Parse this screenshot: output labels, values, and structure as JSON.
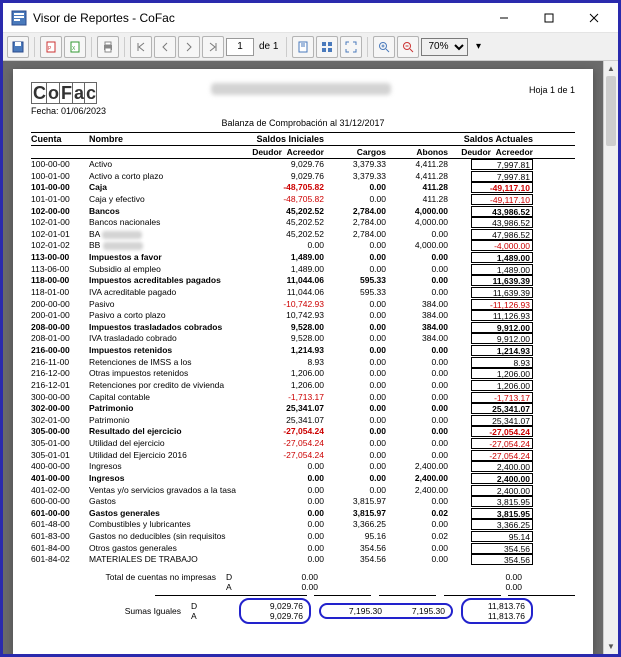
{
  "window": {
    "title": "Visor de Reportes - CoFac"
  },
  "toolbar": {
    "page_input": "1",
    "of_label": "de 1",
    "zoom": "70%"
  },
  "report": {
    "brand": "CoFac",
    "date_label": "Fecha: 01/06/2023",
    "page_label": "Hoja 1 de 1",
    "subtitle": "Balanza de Comprobación al 31/12/2017",
    "headers": {
      "cuenta": "Cuenta",
      "nombre": "Nombre",
      "saldos_iniciales": "Saldos Iniciales",
      "cargos": "Cargos",
      "abonos": "Abonos",
      "saldos_actuales": "Saldos Actuales",
      "deudor": "Deudor",
      "acreedor": "Acreedor"
    },
    "rows": [
      {
        "c": "100-00-00",
        "n": "Activo",
        "si": "9,029.76",
        "cg": "3,379.33",
        "ab": "4,411.28",
        "sa": "7,997.81",
        "bold": false
      },
      {
        "c": "100-01-00",
        "n": "Activo a corto plazo",
        "si": "9,029.76",
        "cg": "3,379.33",
        "ab": "4,411.28",
        "sa": "7,997.81",
        "bold": false
      },
      {
        "c": "101-00-00",
        "n": "Caja",
        "si": "-48,705.82",
        "cg": "0.00",
        "ab": "411.28",
        "sa": "-49,117.10",
        "bold": true,
        "neg_si": true,
        "neg_sa": true
      },
      {
        "c": "101-01-00",
        "n": "Caja y efectivo",
        "si": "-48,705.82",
        "cg": "0.00",
        "ab": "411.28",
        "sa": "-49,117.10",
        "bold": false,
        "neg_si": true,
        "neg_sa": true
      },
      {
        "c": "102-00-00",
        "n": "Bancos",
        "si": "45,202.52",
        "cg": "2,784.00",
        "ab": "4,000.00",
        "sa": "43,986.52",
        "bold": true
      },
      {
        "c": "102-01-00",
        "n": "Bancos nacionales",
        "si": "45,202.52",
        "cg": "2,784.00",
        "ab": "4,000.00",
        "sa": "43,986.52",
        "bold": false
      },
      {
        "c": "102-01-01",
        "n": "BA",
        "si": "45,202.52",
        "cg": "2,784.00",
        "ab": "0.00",
        "sa": "47,986.52",
        "bold": false,
        "blur": true
      },
      {
        "c": "102-01-02",
        "n": "BB",
        "si": "0.00",
        "cg": "0.00",
        "ab": "4,000.00",
        "sa": "-4,000.00",
        "bold": false,
        "blur": true,
        "neg_sa": true
      },
      {
        "c": "113-00-00",
        "n": "Impuestos a favor",
        "si": "1,489.00",
        "cg": "0.00",
        "ab": "0.00",
        "sa": "1,489.00",
        "bold": true
      },
      {
        "c": "113-06-00",
        "n": "Subsidio al empleo",
        "si": "1,489.00",
        "cg": "0.00",
        "ab": "0.00",
        "sa": "1,489.00",
        "bold": false
      },
      {
        "c": "118-00-00",
        "n": "Impuestos acreditables pagados",
        "si": "11,044.06",
        "cg": "595.33",
        "ab": "0.00",
        "sa": "11,639.39",
        "bold": true
      },
      {
        "c": "118-01-00",
        "n": "IVA acreditable pagado",
        "si": "11,044.06",
        "cg": "595.33",
        "ab": "0.00",
        "sa": "11,639.39",
        "bold": false
      },
      {
        "c": "200-00-00",
        "n": "Pasivo",
        "si": "-10,742.93",
        "cg": "0.00",
        "ab": "384.00",
        "sa": "-11,126.93",
        "bold": false,
        "neg_si": true,
        "neg_sa": true
      },
      {
        "c": "200-01-00",
        "n": "Pasivo a corto plazo",
        "si": "10,742.93",
        "cg": "0.00",
        "ab": "384.00",
        "sa": "11,126.93",
        "bold": false
      },
      {
        "c": "208-00-00",
        "n": "Impuestos trasladados cobrados",
        "si": "9,528.00",
        "cg": "0.00",
        "ab": "384.00",
        "sa": "9,912.00",
        "bold": true
      },
      {
        "c": "208-01-00",
        "n": "IVA trasladado cobrado",
        "si": "9,528.00",
        "cg": "0.00",
        "ab": "384.00",
        "sa": "9,912.00",
        "bold": false
      },
      {
        "c": "216-00-00",
        "n": "Impuestos retenidos",
        "si": "1,214.93",
        "cg": "0.00",
        "ab": "0.00",
        "sa": "1,214.93",
        "bold": true
      },
      {
        "c": "216-11-00",
        "n": "Retenciones de IMSS a los",
        "si": "8.93",
        "cg": "0.00",
        "ab": "0.00",
        "sa": "8.93",
        "bold": false
      },
      {
        "c": "216-12-00",
        "n": "Otras impuestos retenidos",
        "si": "1,206.00",
        "cg": "0.00",
        "ab": "0.00",
        "sa": "1,206.00",
        "bold": false
      },
      {
        "c": "216-12-01",
        "n": "Retenciones por credito de vivienda",
        "si": "1,206.00",
        "cg": "0.00",
        "ab": "0.00",
        "sa": "1,206.00",
        "bold": false
      },
      {
        "c": "300-00-00",
        "n": "Capital contable",
        "si": "-1,713.17",
        "cg": "0.00",
        "ab": "0.00",
        "sa": "-1,713.17",
        "bold": false,
        "neg_si": true,
        "neg_sa": true
      },
      {
        "c": "302-00-00",
        "n": "Patrimonio",
        "si": "25,341.07",
        "cg": "0.00",
        "ab": "0.00",
        "sa": "25,341.07",
        "bold": true
      },
      {
        "c": "302-01-00",
        "n": "Patrimonio",
        "si": "25,341.07",
        "cg": "0.00",
        "ab": "0.00",
        "sa": "25,341.07",
        "bold": false
      },
      {
        "c": "305-00-00",
        "n": "Resultado del ejercicio",
        "si": "-27,054.24",
        "cg": "0.00",
        "ab": "0.00",
        "sa": "-27,054.24",
        "bold": true,
        "neg_si": true,
        "neg_sa": true
      },
      {
        "c": "305-01-00",
        "n": "Utilidad del ejercicio",
        "si": "-27,054.24",
        "cg": "0.00",
        "ab": "0.00",
        "sa": "-27,054.24",
        "bold": false,
        "neg_si": true,
        "neg_sa": true
      },
      {
        "c": "305-01-01",
        "n": "Utilidad del Ejercicio 2016",
        "si": "-27,054.24",
        "cg": "0.00",
        "ab": "0.00",
        "sa": "-27,054.24",
        "bold": false,
        "neg_si": true,
        "neg_sa": true
      },
      {
        "c": "400-00-00",
        "n": "Ingresos",
        "si": "0.00",
        "cg": "0.00",
        "ab": "2,400.00",
        "sa": "2,400.00",
        "bold": false
      },
      {
        "c": "401-00-00",
        "n": "Ingresos",
        "si": "0.00",
        "cg": "0.00",
        "ab": "2,400.00",
        "sa": "2,400.00",
        "bold": true
      },
      {
        "c": "401-02-00",
        "n": "Ventas y/o servicios gravados a la tasa",
        "si": "0.00",
        "cg": "0.00",
        "ab": "2,400.00",
        "sa": "2,400.00",
        "bold": false
      },
      {
        "c": "600-00-00",
        "n": "Gastos",
        "si": "0.00",
        "cg": "3,815.97",
        "ab": "0.00",
        "sa": "3,815.95",
        "bold": false
      },
      {
        "c": "601-00-00",
        "n": "Gastos generales",
        "si": "0.00",
        "cg": "3,815.97",
        "ab": "0.02",
        "sa": "3,815.95",
        "bold": true
      },
      {
        "c": "601-48-00",
        "n": "Combustibles y lubricantes",
        "si": "0.00",
        "cg": "3,366.25",
        "ab": "0.00",
        "sa": "3,366.25",
        "bold": false
      },
      {
        "c": "601-83-00",
        "n": "Gastos no deducibles (sin requisitos",
        "si": "0.00",
        "cg": "95.16",
        "ab": "0.02",
        "sa": "95.14",
        "bold": false
      },
      {
        "c": "601-84-00",
        "n": "Otros gastos generales",
        "si": "0.00",
        "cg": "354.56",
        "ab": "0.00",
        "sa": "354.56",
        "bold": false
      },
      {
        "c": "601-84-02",
        "n": "MATERIALES DE TRABAJO",
        "si": "0.00",
        "cg": "354.56",
        "ab": "0.00",
        "sa": "354.56",
        "bold": false
      }
    ],
    "totals": {
      "no_impresas_label": "Total de cuentas no impresas",
      "sumas_label": "Sumas Iguales",
      "D": "D",
      "A": "A",
      "ni_d_si": "0.00",
      "ni_a_si": "0.00",
      "ni_d_sa": "0.00",
      "ni_a_sa": "0.00",
      "sum_d_si": "9,029.76",
      "sum_a_si": "9,029.76",
      "sum_cargo": "7,195.30",
      "sum_abono": "7,195.30",
      "sum_d_sa": "11,813.76",
      "sum_a_sa": "11,813.76"
    }
  }
}
